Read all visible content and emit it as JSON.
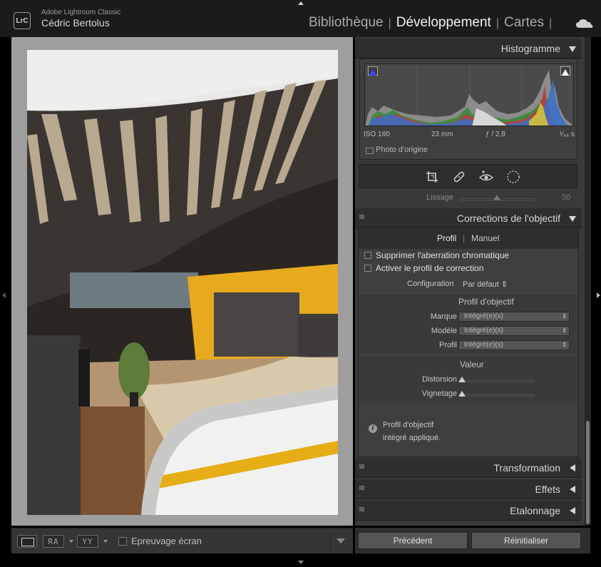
{
  "app": {
    "logo_text": "LrC",
    "name": "Adobe Lightroom Classic",
    "user": "Cédric Bertolus"
  },
  "modules": {
    "library": "Bibliothèque",
    "develop": "Développement",
    "maps": "Cartes",
    "separator": "|"
  },
  "toolbar": {
    "before_after_lr": "RA",
    "before_after_tb": "YY",
    "soft_proof_label": "Epreuvage écran",
    "soft_proof_checked": false
  },
  "histogram": {
    "title": "Histogramme",
    "iso": "ISO 160",
    "focal": "23 mm",
    "aperture": "ƒ / 2,8",
    "shutter": "¹⁄₄₅ s",
    "original_photo_label": "Photo d'origine"
  },
  "tools": [
    "crop-icon",
    "healing-icon",
    "redeye-icon",
    "mask-icon"
  ],
  "detail": {
    "smoothing_label": "Lissage",
    "smoothing_value": "50"
  },
  "lens_corrections": {
    "title": "Corrections de l'objectif",
    "tab_profile": "Profil",
    "tab_separator": "|",
    "tab_manual": "Manuel",
    "remove_ca_label": "Supprimer l'aberration chromatique",
    "remove_ca_checked": false,
    "enable_profile_label": "Activer le profil de correction",
    "enable_profile_checked": false,
    "setup_label": "Configuration",
    "setup_value": "Par défaut",
    "lens_profile_title": "Profil d'objectif",
    "make_label": "Marque",
    "make_value": "Intégré(e)(s)",
    "model_label": "Modèle",
    "model_value": "Intégré(e)(s)",
    "profile_label": "Profil",
    "profile_value": "Intégré(e)(s)",
    "amount_title": "Valeur",
    "distortion_label": "Distorsion",
    "vignetting_label": "Vignetage",
    "info_line1": "Profil d'objectif",
    "info_line2": "intégré appliqué."
  },
  "collapsed_panels": {
    "transform": "Transformation",
    "effects": "Effets",
    "calibration": "Etalonnage"
  },
  "buttons": {
    "previous": "Précédent",
    "reset": "Réinitialiser"
  },
  "colors": {
    "accent_yellow": "#f2b417",
    "panel_bg": "#3a3a3a",
    "header_bg": "#2e2e2e"
  }
}
